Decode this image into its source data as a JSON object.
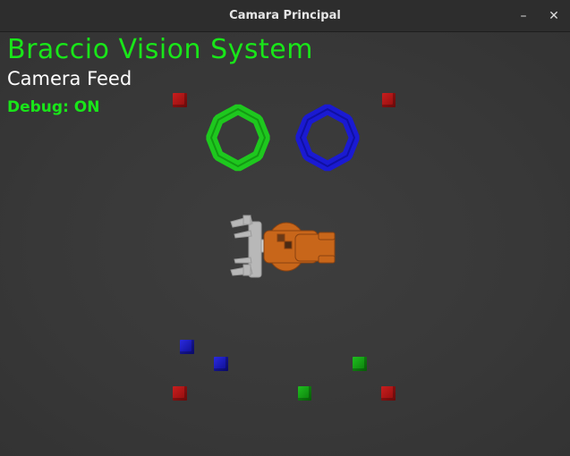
{
  "window": {
    "title": "Camara Principal",
    "minimize_glyph": "–",
    "close_glyph": "✕"
  },
  "hud": {
    "title": "Braccio Vision System",
    "subtitle": "Camera Feed",
    "debug": "Debug: ON"
  },
  "scene": {
    "ring_colors": {
      "green": "#1ec81e",
      "blue": "#1a1ad2"
    },
    "robot_color": "#c8661a",
    "gripper_color": "#b4b4b4"
  }
}
